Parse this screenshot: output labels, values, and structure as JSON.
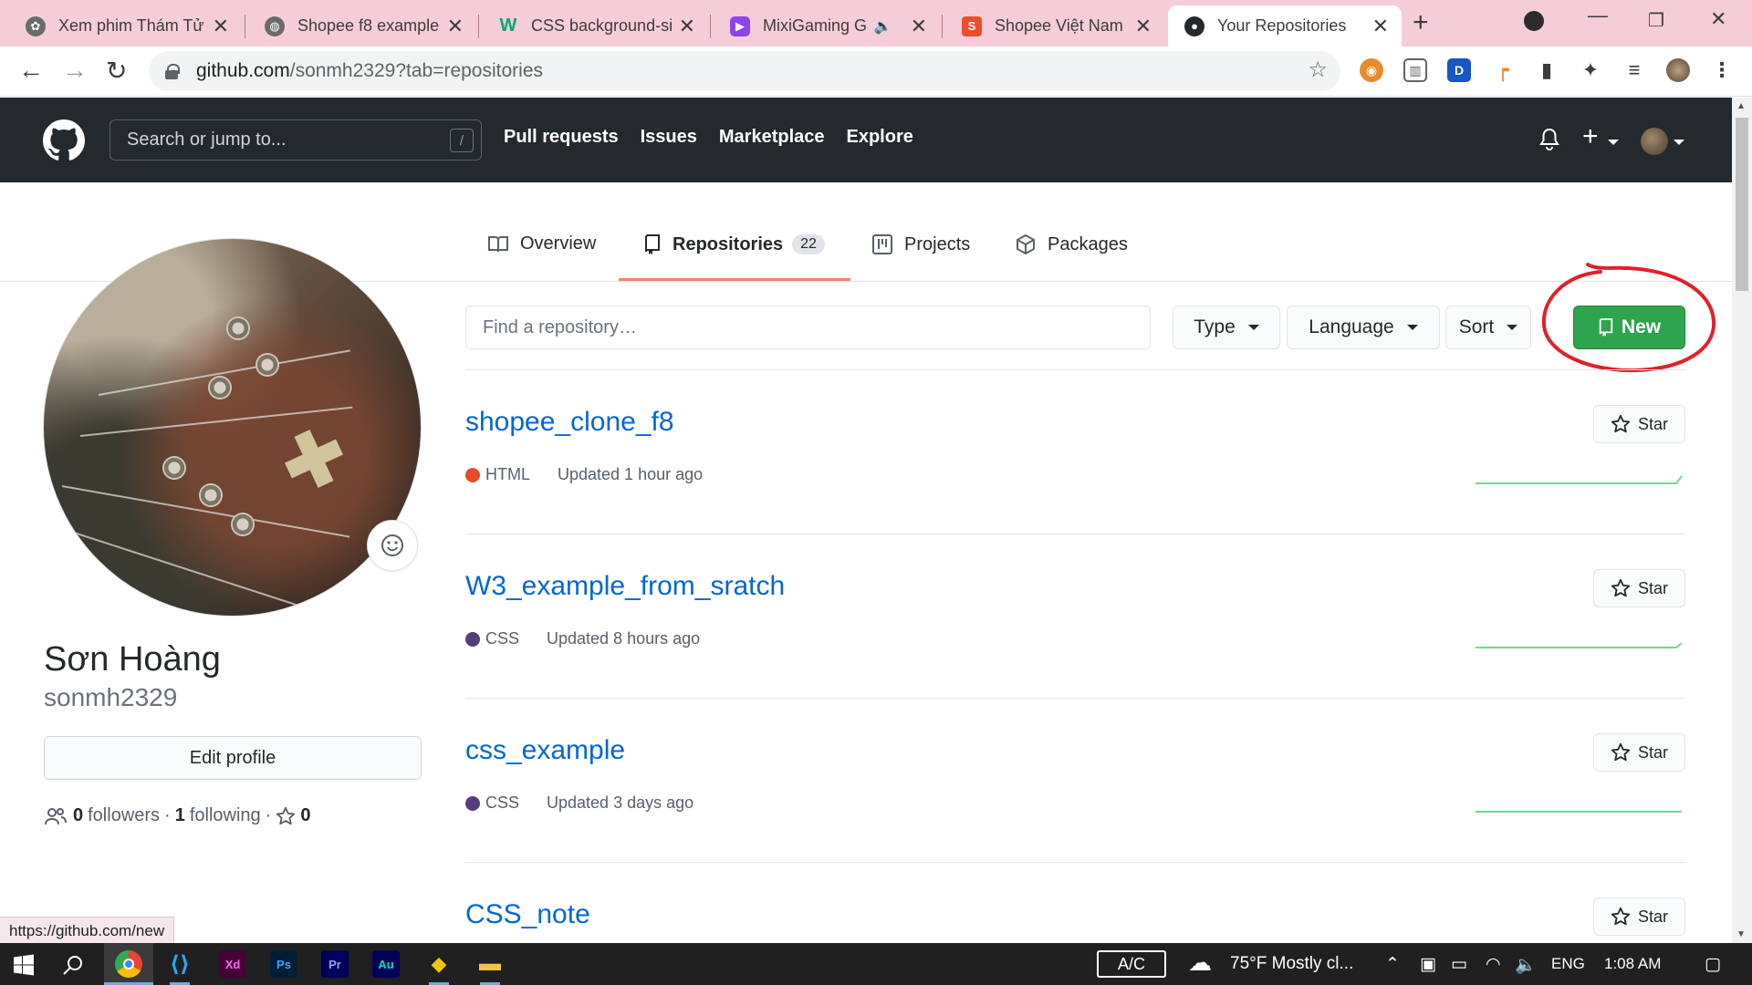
{
  "browser": {
    "tabs": [
      {
        "title": "Xem phim Thám Tử",
        "favicon_color": "#6b6b6b"
      },
      {
        "title": "Shopee f8 example",
        "favicon_color": "#6b6b6b"
      },
      {
        "title": "CSS background-siz",
        "favicon_color": "#04aa6d",
        "favicon_text": "W"
      },
      {
        "title": "MixiGaming GTA",
        "favicon_color": "#8e44ec"
      },
      {
        "title": "Shopee Việt Nam |",
        "favicon_color": "#ee4d2d"
      },
      {
        "title": "Your Repositories",
        "favicon_color": "#24292e"
      }
    ],
    "url_host": "github.com",
    "url_rest": "/sonmh2329?tab=repositories",
    "status_url": "https://github.com/new"
  },
  "github": {
    "search_placeholder": "Search or jump to...",
    "search_shortcut": "/",
    "nav": [
      "Pull requests",
      "Issues",
      "Marketplace",
      "Explore"
    ],
    "profile_tabs": {
      "overview": "Overview",
      "repositories": "Repositories",
      "repositories_count": "22",
      "projects": "Projects",
      "packages": "Packages"
    },
    "profile": {
      "fullname": "Sơn Hoàng",
      "username": "sonmh2329",
      "edit_label": "Edit profile",
      "followers_count": "0",
      "followers_label": "followers",
      "following_count": "1",
      "following_label": "following",
      "stars_count": "0"
    },
    "filters": {
      "find_placeholder": "Find a repository…",
      "type": "Type",
      "language": "Language",
      "sort": "Sort",
      "new": "New"
    },
    "repos": [
      {
        "name": "shopee_clone_f8",
        "language": "HTML",
        "language_color": "#e34c26",
        "updated": "Updated 1 hour ago"
      },
      {
        "name": "W3_example_from_sratch",
        "language": "CSS",
        "language_color": "#563d7c",
        "updated": "Updated 8 hours ago"
      },
      {
        "name": "css_example",
        "language": "CSS",
        "language_color": "#563d7c",
        "updated": "Updated 3 days ago"
      },
      {
        "name": "CSS_note",
        "language": "",
        "language_color": "",
        "updated": ""
      }
    ],
    "star_label": "Star"
  },
  "taskbar": {
    "ac_label": "A/C",
    "weather": "75°F  Mostly cl...",
    "language": "ENG",
    "time": "1:08 AM"
  },
  "colors": {
    "accent_new": "#2ea44f",
    "link": "#0366d6",
    "header_bg": "#24292e",
    "tab_underline": "#f9826c",
    "annotation": "#e0202a"
  }
}
